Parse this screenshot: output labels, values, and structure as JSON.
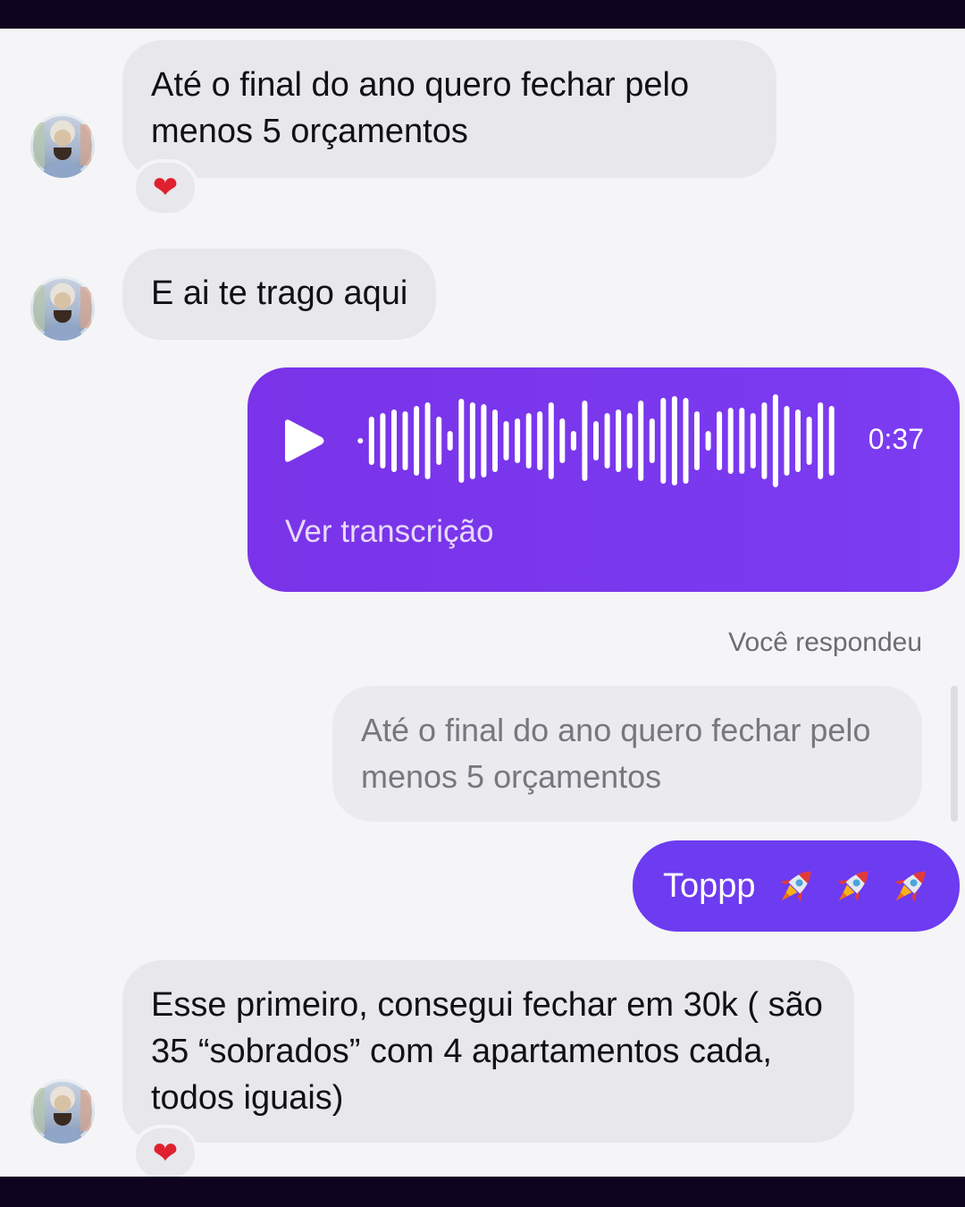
{
  "messages": {
    "m1": {
      "text": "Até o final do ano quero fechar pelo menos 5 orçamentos",
      "reaction": "❤"
    },
    "m2": {
      "text": "E ai te trago aqui"
    },
    "voice": {
      "duration": "0:37",
      "transcript_link": "Ver transcrição"
    },
    "reply": {
      "label": "Você respondeu",
      "quoted": "Até o final do ano quero fechar pelo menos 5 orçamentos"
    },
    "m3": {
      "text": "Toppp",
      "emojis": [
        "rocket",
        "rocket",
        "rocket"
      ]
    },
    "m4": {
      "text": "Esse primeiro, consegui fechar em 30k ( são 35 “sobrados” com 4 apartamentos cada, todos iguais)",
      "reaction": "❤"
    }
  },
  "icons": {
    "play": "play-icon",
    "waveform": "waveform-icon",
    "rocket": "rocket-emoji",
    "heart": "heart-emoji",
    "avatar": "contact-avatar"
  },
  "colors": {
    "outgoing_bubble": "#6d3bf0",
    "voice_bubble": "#7b3cf2",
    "incoming_bubble": "#e7e7ec",
    "heart": "#e0202e"
  }
}
